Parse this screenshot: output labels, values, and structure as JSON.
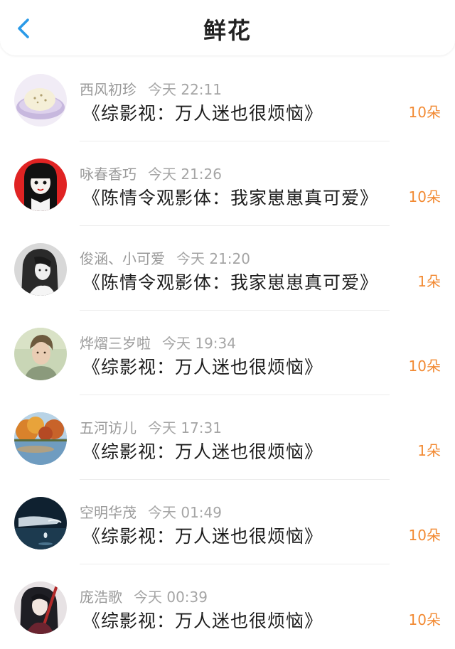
{
  "header": {
    "title": "鲜花",
    "back_icon": "chevron-left-icon",
    "accent_color": "#2a9ae8"
  },
  "colors": {
    "amount": "#f28a33",
    "meta": "#9a9a9a",
    "book": "#1c1c1c"
  },
  "items": [
    {
      "name": "西风初珍",
      "time": "今天 22:11",
      "book": "《综影视：万人迷也很烦恼》",
      "amount": "10朵",
      "avatar": "bread-bowl-avatar"
    },
    {
      "name": "咏春香巧",
      "time": "今天 21:26",
      "book": "《陈情令观影体：我家崽崽真可爱》",
      "amount": "10朵",
      "avatar": "anime-girl-red-avatar"
    },
    {
      "name": "俊涵、小可爱",
      "time": "今天 21:20",
      "book": "《陈情令观影体：我家崽崽真可爱》",
      "amount": "1朵",
      "avatar": "bw-girl-avatar"
    },
    {
      "name": "烨熠三岁啦",
      "time": "今天 19:34",
      "book": "《综影视：万人迷也很烦恼》",
      "amount": "10朵",
      "avatar": "young-man-avatar"
    },
    {
      "name": "五河访儿",
      "time": "今天 17:31",
      "book": "《综影视：万人迷也很烦恼》",
      "amount": "1朵",
      "avatar": "autumn-lake-avatar"
    },
    {
      "name": "空明华茂",
      "time": "今天 01:49",
      "book": "《综影视：万人迷也很烦恼》",
      "amount": "10朵",
      "avatar": "water-drop-hand-avatar"
    },
    {
      "name": "庞浩歌",
      "time": "今天 00:39",
      "book": "《综影视：万人迷也很烦恼》",
      "amount": "10朵",
      "avatar": "ancient-costume-avatar"
    }
  ]
}
